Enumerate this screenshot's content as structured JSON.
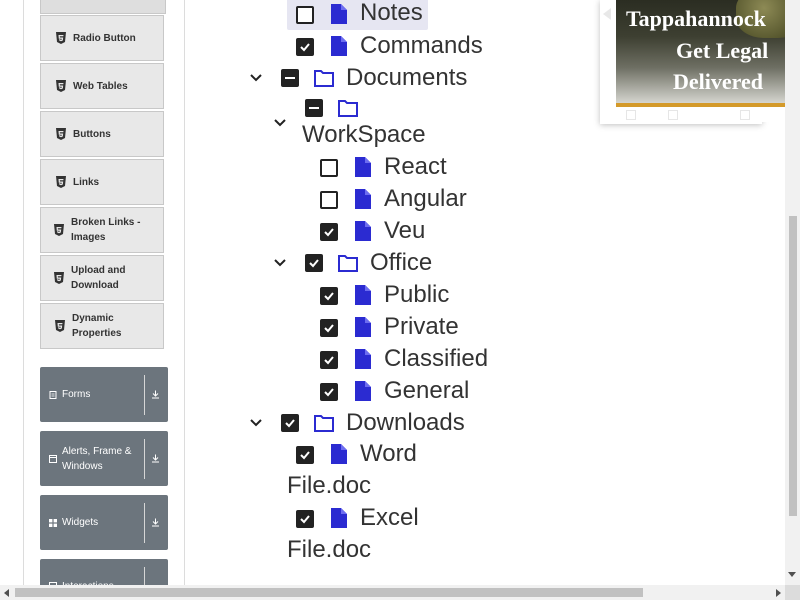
{
  "sidebar": {
    "sub_items": [
      {
        "label": "Radio Button"
      },
      {
        "label": "Web Tables"
      },
      {
        "label": "Buttons"
      },
      {
        "label": "Links"
      },
      {
        "label": "Broken Links - Images"
      },
      {
        "label": "Upload and Download"
      },
      {
        "label": "Dynamic Properties"
      }
    ],
    "groups": [
      {
        "label": "Forms",
        "icon": "form-icon"
      },
      {
        "label": "Alerts, Frame & Windows",
        "icon": "window-icon"
      },
      {
        "label": "Widgets",
        "icon": "widgets-icon"
      },
      {
        "label": "Interactions",
        "icon": "interactions-icon"
      }
    ]
  },
  "tree": {
    "notes": "Notes",
    "commands": "Commands",
    "documents": "Documents",
    "workspace": "WorkSpace",
    "react": "React",
    "angular": "Angular",
    "veu": "Veu",
    "office": "Office",
    "public": "Public",
    "private": "Private",
    "classified": "Classified",
    "general": "General",
    "downloads": "Downloads",
    "word_line1": "Word",
    "word_line2": "File.doc",
    "excel_line1": "Excel",
    "excel_line2": "File.doc"
  },
  "ad": {
    "line1": "Tappahannock",
    "line2": "Get Legal",
    "line3": "Delivered"
  },
  "colors": {
    "accent_icon": "#2b2bd1",
    "sidebar_group": "#6c757d",
    "ad_bar": "#d49a2a"
  }
}
